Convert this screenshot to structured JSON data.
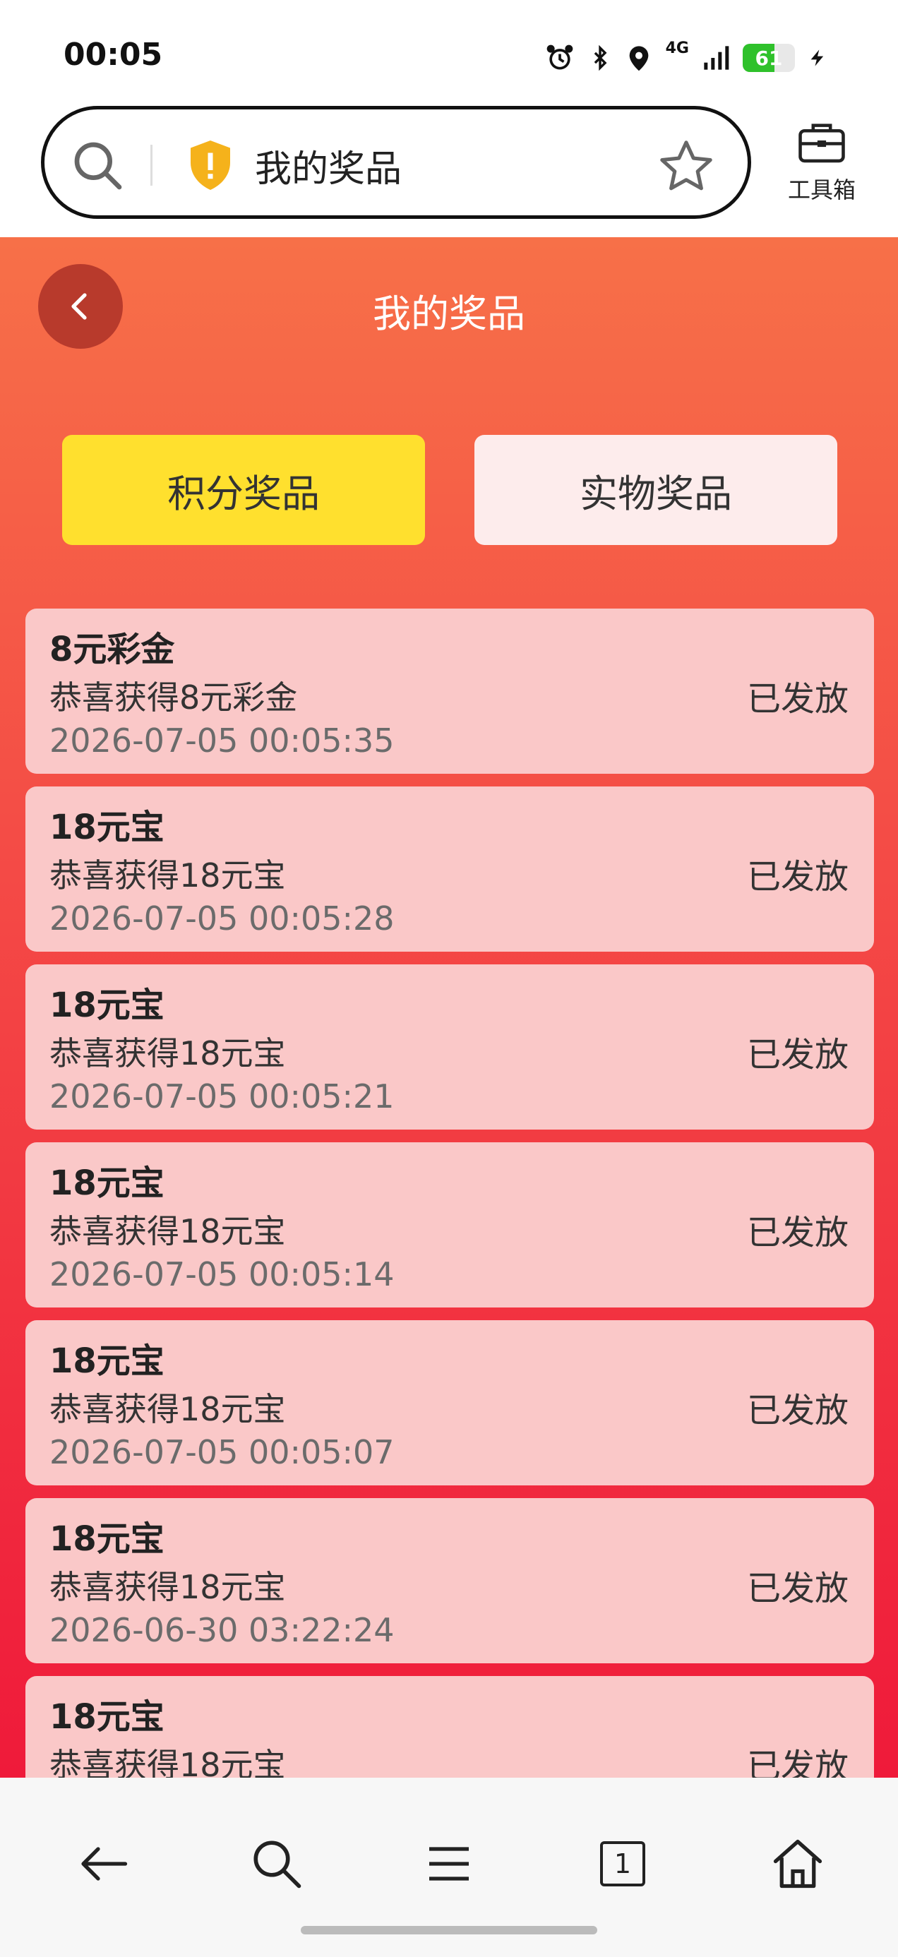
{
  "status_bar": {
    "time": "00:05",
    "network": "4G",
    "battery_level": "61"
  },
  "browser": {
    "url_title": "我的奖品",
    "toolbox_label": "工具箱"
  },
  "page": {
    "title": "我的奖品",
    "tabs": [
      {
        "label": "积分奖品",
        "active": true
      },
      {
        "label": "实物奖品",
        "active": false
      }
    ],
    "items": [
      {
        "title": "8元彩金",
        "desc": "恭喜获得8元彩金",
        "time": "2026-07-05 00:05:35",
        "status": "已发放"
      },
      {
        "title": "18元宝",
        "desc": "恭喜获得18元宝",
        "time": "2026-07-05 00:05:28",
        "status": "已发放"
      },
      {
        "title": "18元宝",
        "desc": "恭喜获得18元宝",
        "time": "2026-07-05 00:05:21",
        "status": "已发放"
      },
      {
        "title": "18元宝",
        "desc": "恭喜获得18元宝",
        "time": "2026-07-05 00:05:14",
        "status": "已发放"
      },
      {
        "title": "18元宝",
        "desc": "恭喜获得18元宝",
        "time": "2026-07-05 00:05:07",
        "status": "已发放"
      },
      {
        "title": "18元宝",
        "desc": "恭喜获得18元宝",
        "time": "2026-06-30 03:22:24",
        "status": "已发放"
      },
      {
        "title": "18元宝",
        "desc": "恭喜获得18元宝",
        "time": "",
        "status": "已发放"
      }
    ]
  },
  "bottom_nav": {
    "tab_count": "1"
  },
  "colors": {
    "accent_yellow": "#ffe02e",
    "header_orange": "#f77048",
    "page_red": "#ef1a3a",
    "card_pink": "#fac8c8"
  }
}
